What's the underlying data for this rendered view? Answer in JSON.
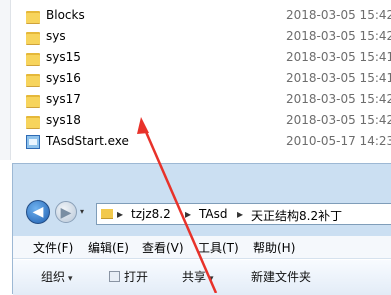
{
  "files": [
    {
      "name": "Blocks",
      "date": "2018-03-05 15:42",
      "icon": "folder-icon"
    },
    {
      "name": "sys",
      "date": "2018-03-05 15:42",
      "icon": "folder-icon"
    },
    {
      "name": "sys15",
      "date": "2018-03-05 15:41",
      "icon": "folder-icon"
    },
    {
      "name": "sys16",
      "date": "2018-03-05 15:41",
      "icon": "folder-icon"
    },
    {
      "name": "sys17",
      "date": "2018-03-05 15:42",
      "icon": "folder-icon"
    },
    {
      "name": "sys18",
      "date": "2018-03-05 15:42",
      "icon": "folder-icon"
    },
    {
      "name": "TAsdStart.exe",
      "date": "2010-05-17 14:23",
      "icon": "exe-file-icon"
    }
  ],
  "explorer": {
    "nav": {
      "back_glyph": "◀",
      "forward_glyph": "▶",
      "history_glyph": "▾"
    },
    "address": {
      "sep": "▸",
      "crumbs": [
        "tzjz8.2",
        "TAsd",
        "天正结构8.2补丁"
      ]
    },
    "menu": [
      "文件(F)",
      "编辑(E)",
      "查看(V)",
      "工具(T)",
      "帮助(H)"
    ],
    "toolbar": {
      "organize": "组织",
      "open": "打开",
      "share": "共享",
      "new_folder": "新建文件夹",
      "caret": "▾"
    }
  },
  "colors": {
    "annotation_arrow": "#e8322a",
    "folder": "#f2c94c",
    "explorer_frame": "#cbdff2"
  }
}
